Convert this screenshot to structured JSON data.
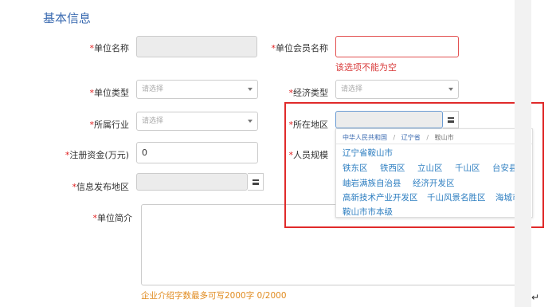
{
  "section_title": "基本信息",
  "required_mark": "*",
  "fields": {
    "unit_name": {
      "label": "单位名称",
      "value": ""
    },
    "member_name": {
      "label": "单位会员名称",
      "value": "",
      "error": "该选项不能为空"
    },
    "unit_type": {
      "label": "单位类型",
      "placeholder": "请选择"
    },
    "economy_type": {
      "label": "经济类型",
      "placeholder": "请选择"
    },
    "industry": {
      "label": "所属行业",
      "placeholder": "请选择"
    },
    "region": {
      "label": "所在地区",
      "value": ""
    },
    "capital": {
      "label": "注册资金(万元)",
      "value": "0"
    },
    "staff_size": {
      "label": "人员规模"
    },
    "publish_region": {
      "label": "信息发布地区",
      "value": ""
    },
    "intro": {
      "label": "单位简介",
      "value": "",
      "hint": "企业介绍字数最多可写2000字 0/2000"
    }
  },
  "region_dropdown": {
    "breadcrumb": [
      "中华人民共和国",
      "辽宁省",
      "鞍山市"
    ],
    "separator": "/",
    "rows": [
      [
        "辽宁省鞍山市"
      ],
      [
        "铁东区",
        "铁西区",
        "立山区",
        "千山区",
        "台安县"
      ],
      [
        "岫岩满族自治县",
        "经济开发区"
      ],
      [
        "高新技术产业开发区",
        "千山风景名胜区",
        "海城市"
      ],
      [
        "鞍山市市本级"
      ]
    ]
  },
  "pilcrow": "↵",
  "colors": {
    "title": "#3a6ab0",
    "required": "#e02020",
    "error": "#d93b3b",
    "link": "#2f7fc1",
    "hint": "#e08a1e",
    "highlight": "#e02a2a"
  }
}
